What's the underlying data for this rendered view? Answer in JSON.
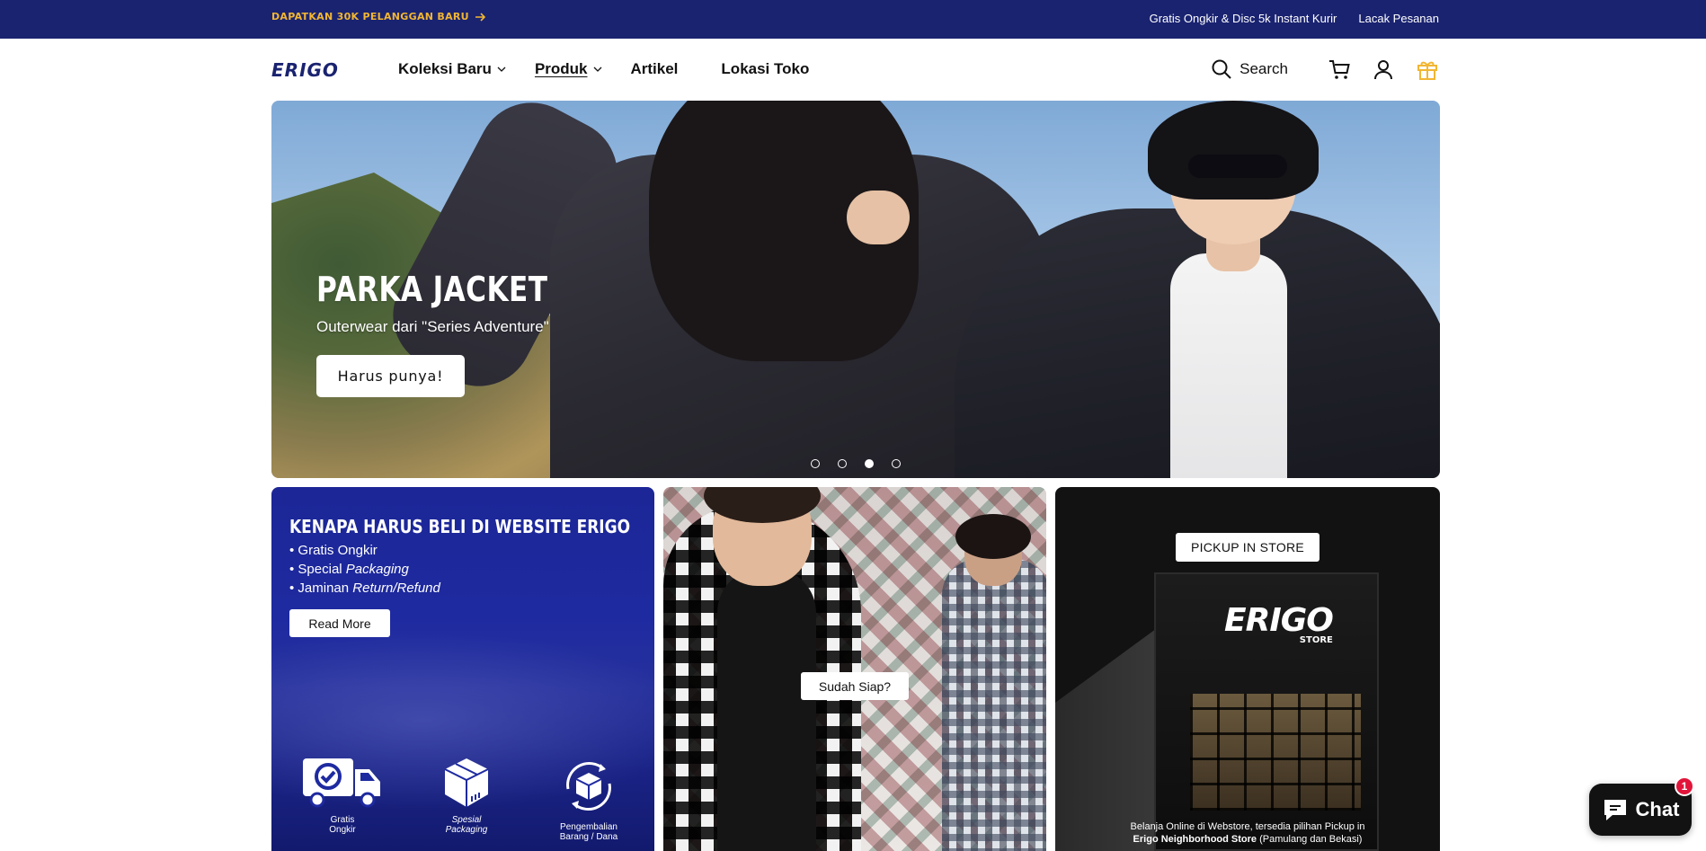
{
  "announcement": {
    "promo_text": "DAPATKAN 30K PELANGGAN BARU",
    "promo_icon": "arrow-right-icon",
    "shipping_text": "Gratis Ongkir & Disc 5k Instant Kurir",
    "track_order": "Lacak Pesanan",
    "bg_color": "#1a2370",
    "promo_color": "#f2b632"
  },
  "header": {
    "logo_text": "ERIGO",
    "nav": [
      {
        "label": "Koleksi Baru",
        "has_dropdown": true
      },
      {
        "label": "Produk",
        "has_dropdown": true,
        "active": true
      },
      {
        "label": "Artikel",
        "has_dropdown": false
      },
      {
        "label": "Lokasi Toko",
        "has_dropdown": false
      }
    ],
    "search_label": "Search",
    "icons": [
      "search-icon",
      "cart-icon",
      "account-icon",
      "gift-icon"
    ],
    "gift_color": "#f2b632"
  },
  "hero": {
    "title": "PARKA JACKET",
    "subtitle": "Outerwear dari \"Series Adventure\"",
    "button_label": "Harus punya!",
    "slides": 4,
    "active_slide": 3
  },
  "cards": {
    "why": {
      "title": "KENAPA HARUS BELI DI WEBSITE ERIGO",
      "bullets": [
        {
          "prefix": "• Gratis Ongkir",
          "italic": ""
        },
        {
          "prefix": "• Special ",
          "italic": "Packaging"
        },
        {
          "prefix": "• Jaminan ",
          "italic": "Return/Refund"
        }
      ],
      "button_label": "Read More",
      "features": [
        {
          "icon": "delivery-truck-icon",
          "label": "Gratis\nOngkir"
        },
        {
          "icon": "package-box-icon",
          "label": "Spesial\nPackaging"
        },
        {
          "icon": "return-refund-icon",
          "label": "Pengembalian\nBarang / Dana"
        }
      ]
    },
    "ready": {
      "button_label": "Sudah Siap?"
    },
    "pickup": {
      "button_label": "PICKUP IN STORE",
      "store_logo": "ERIGO",
      "store_logo_sub": "STORE",
      "caption_line1": "Belanja Online di Webstore, tersedia pilihan Pickup in",
      "caption_bold": "Erigo Neighborhood Store",
      "caption_rest": " (Pamulang dan Bekasi)"
    }
  },
  "chat": {
    "label": "Chat",
    "badge": "1",
    "icon": "chat-bubble-icon"
  }
}
